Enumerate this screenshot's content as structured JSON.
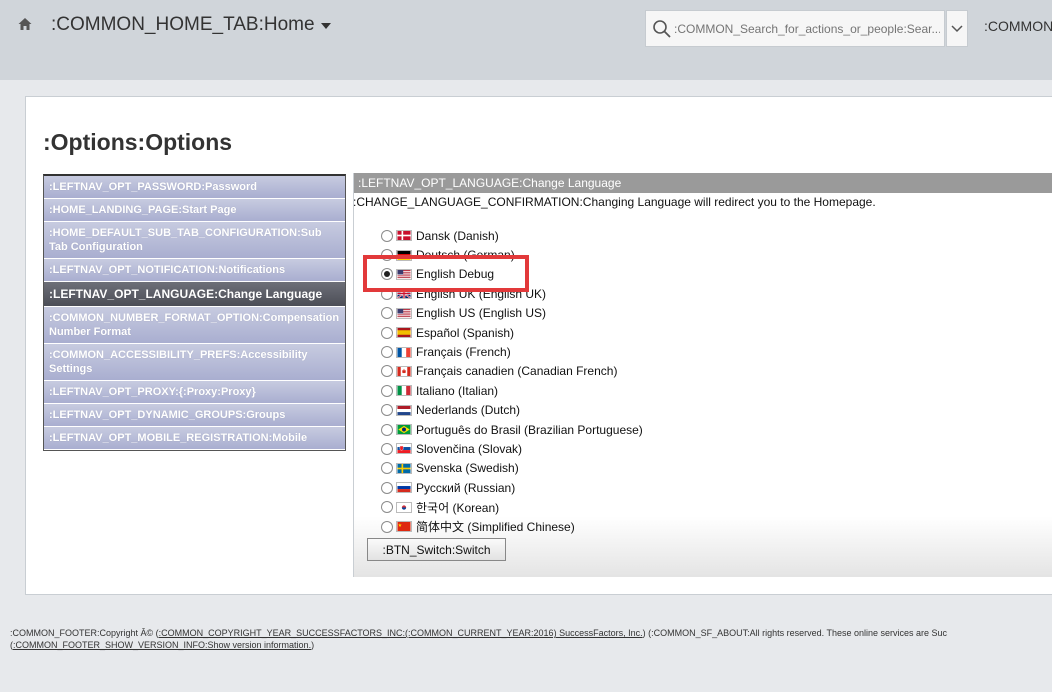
{
  "header": {
    "home_title": ":COMMON_HOME_TAB:Home",
    "search_placeholder": ":COMMON_Search_for_actions_or_people:Sear...",
    "right_text": ":COMMON_"
  },
  "page": {
    "title": ":Options:Options"
  },
  "leftnav": {
    "items": [
      {
        "label": ":LEFTNAV_OPT_PASSWORD:Password",
        "active": false
      },
      {
        "label": ":HOME_LANDING_PAGE:Start Page",
        "active": false
      },
      {
        "label": ":HOME_DEFAULT_SUB_TAB_CONFIGURATION:Sub Tab Configuration",
        "active": false
      },
      {
        "label": ":LEFTNAV_OPT_NOTIFICATION:Notifications",
        "active": false
      },
      {
        "label": ":LEFTNAV_OPT_LANGUAGE:Change Language",
        "active": true
      },
      {
        "label": ":COMMON_NUMBER_FORMAT_OPTION:Compensation Number Format",
        "active": false
      },
      {
        "label": ":COMMON_ACCESSIBILITY_PREFS:Accessibility Settings",
        "active": false
      },
      {
        "label": ":LEFTNAV_OPT_PROXY:{:Proxy:Proxy}",
        "active": false
      },
      {
        "label": ":LEFTNAV_OPT_DYNAMIC_GROUPS:Groups",
        "active": false
      },
      {
        "label": ":LEFTNAV_OPT_MOBILE_REGISTRATION:Mobile",
        "active": false
      }
    ]
  },
  "content": {
    "header": ":LEFTNAV_OPT_LANGUAGE:Change Language",
    "confirmation": ":CHANGE_LANGUAGE_CONFIRMATION:Changing Language will redirect you to the Homepage.",
    "languages": [
      {
        "label": "Dansk (Danish)",
        "flag": "dk-flag-icon",
        "selected": false
      },
      {
        "label": "Deutsch (German)",
        "flag": "de-flag-icon",
        "selected": false
      },
      {
        "label": "English Debug",
        "flag": "us-flag-icon",
        "selected": true
      },
      {
        "label": "English UK (English UK)",
        "flag": "uk-flag-icon",
        "selected": false
      },
      {
        "label": "English US (English US)",
        "flag": "us-flag-icon",
        "selected": false
      },
      {
        "label": "Español (Spanish)",
        "flag": "es-flag-icon",
        "selected": false
      },
      {
        "label": "Français (French)",
        "flag": "fr-flag-icon",
        "selected": false
      },
      {
        "label": "Français canadien (Canadian French)",
        "flag": "ca-flag-icon",
        "selected": false
      },
      {
        "label": "Italiano (Italian)",
        "flag": "it-flag-icon",
        "selected": false
      },
      {
        "label": "Nederlands (Dutch)",
        "flag": "nl-flag-icon",
        "selected": false
      },
      {
        "label": "Português do Brasil (Brazilian Portuguese)",
        "flag": "br-flag-icon",
        "selected": false
      },
      {
        "label": "Slovenčina (Slovak)",
        "flag": "sk-flag-icon",
        "selected": false
      },
      {
        "label": "Svenska (Swedish)",
        "flag": "se-flag-icon",
        "selected": false
      },
      {
        "label": "Русский (Russian)",
        "flag": "ru-flag-icon",
        "selected": false
      },
      {
        "label": "한국어 (Korean)",
        "flag": "kr-flag-icon",
        "selected": false
      },
      {
        "label": "简体中文 (Simplified Chinese)",
        "flag": "cn-flag-icon",
        "selected": false
      }
    ],
    "switch_button": ":BTN_Switch:Switch"
  },
  "footer": {
    "line1_prefix": ":COMMON_FOOTER:Copyright Â© (",
    "copyright_link": ":COMMON_COPYRIGHT_YEAR_SUCCESSFACTORS_INC:(:COMMON_CURRENT_YEAR:2016) SuccessFactors, Inc.",
    "line1_suffix": ") (:COMMON_SF_ABOUT:All rights reserved. These online services are Suc",
    "line2_open": "(",
    "version_link": ":COMMON_FOOTER_SHOW_VERSION_INFO:Show version information.",
    "line2_close": ")"
  },
  "colors": {
    "highlight": "#e2393a",
    "nav_active": "#4c4e57",
    "nav_item": "#a9aed0",
    "content_header": "#9a9a9a"
  }
}
